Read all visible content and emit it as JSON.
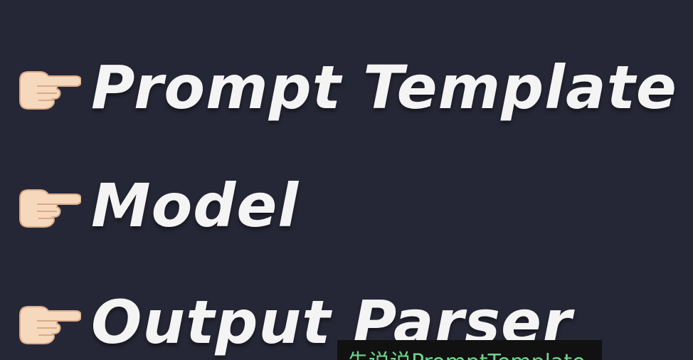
{
  "bullets": [
    {
      "icon": "pointing-right-hand-icon",
      "label": "Prompt Template"
    },
    {
      "icon": "pointing-right-hand-icon",
      "label": "Model"
    },
    {
      "icon": "pointing-right-hand-icon",
      "label": "Output Parser"
    }
  ],
  "subtitle": {
    "text": "先说说PromptTemplate"
  },
  "colors": {
    "background": "#262736",
    "text": "#f4f4f4",
    "subtitle_bg": "#111111",
    "subtitle_text": "#6ed48a",
    "hand_skin": "#f6d8bc"
  }
}
